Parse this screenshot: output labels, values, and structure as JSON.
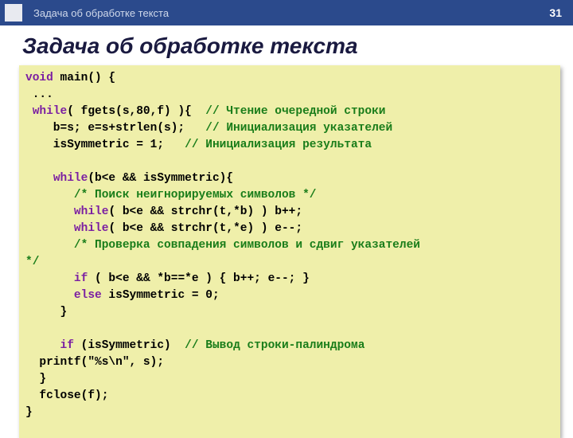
{
  "header": {
    "breadcrumb": "Задача об обработке текста",
    "page_number": "31"
  },
  "slide_title": "Задача об обработке текста",
  "code": {
    "lines": [
      [
        {
          "c": "kw",
          "t": "void"
        },
        {
          "c": "tx",
          "t": " main() {"
        }
      ],
      [
        {
          "c": "tx",
          "t": " ..."
        }
      ],
      [
        {
          "c": "tx",
          "t": " "
        },
        {
          "c": "kw",
          "t": "while"
        },
        {
          "c": "tx",
          "t": "( fgets(s,80,f) ){  "
        },
        {
          "c": "cm",
          "t": "// Чтение очередной строки"
        }
      ],
      [
        {
          "c": "tx",
          "t": "    b=s; e=s+strlen(s);   "
        },
        {
          "c": "cm",
          "t": "// Инициализация указателей"
        }
      ],
      [
        {
          "c": "tx",
          "t": "    isSymmetric = 1;   "
        },
        {
          "c": "cm",
          "t": "// Инициализация результата"
        }
      ],
      [
        {
          "c": "tx",
          "t": ""
        }
      ],
      [
        {
          "c": "tx",
          "t": "    "
        },
        {
          "c": "kw",
          "t": "while"
        },
        {
          "c": "tx",
          "t": "(b<e && isSymmetric){"
        }
      ],
      [
        {
          "c": "tx",
          "t": "       "
        },
        {
          "c": "cm",
          "t": "/* Поиск неигнорируемых символов */"
        }
      ],
      [
        {
          "c": "tx",
          "t": "       "
        },
        {
          "c": "kw",
          "t": "while"
        },
        {
          "c": "tx",
          "t": "( b<e && strchr(t,*b) ) b++;"
        }
      ],
      [
        {
          "c": "tx",
          "t": "       "
        },
        {
          "c": "kw",
          "t": "while"
        },
        {
          "c": "tx",
          "t": "( b<e && strchr(t,*e) ) e--;"
        }
      ],
      [
        {
          "c": "tx",
          "t": "       "
        },
        {
          "c": "cm",
          "t": "/* Проверка совпадения символов и сдвиг указателей"
        }
      ],
      [
        {
          "c": "cm",
          "t": "*/"
        }
      ],
      [
        {
          "c": "tx",
          "t": "       "
        },
        {
          "c": "kw",
          "t": "if"
        },
        {
          "c": "tx",
          "t": " ( b<e && *b==*e ) { b++; e--; }"
        }
      ],
      [
        {
          "c": "tx",
          "t": "       "
        },
        {
          "c": "kw",
          "t": "else"
        },
        {
          "c": "tx",
          "t": " isSymmetric = 0;"
        }
      ],
      [
        {
          "c": "tx",
          "t": "     }"
        }
      ],
      [
        {
          "c": "tx",
          "t": ""
        }
      ],
      [
        {
          "c": "tx",
          "t": "     "
        },
        {
          "c": "kw",
          "t": "if"
        },
        {
          "c": "tx",
          "t": " (isSymmetric)  "
        },
        {
          "c": "cm",
          "t": "// Вывод строки-палиндрома"
        }
      ],
      [
        {
          "c": "tx",
          "t": "  printf(\"%s\\n\", s);"
        }
      ],
      [
        {
          "c": "tx",
          "t": "  }"
        }
      ],
      [
        {
          "c": "tx",
          "t": "  fclose(f);"
        }
      ],
      [
        {
          "c": "tx",
          "t": "}"
        }
      ]
    ]
  }
}
